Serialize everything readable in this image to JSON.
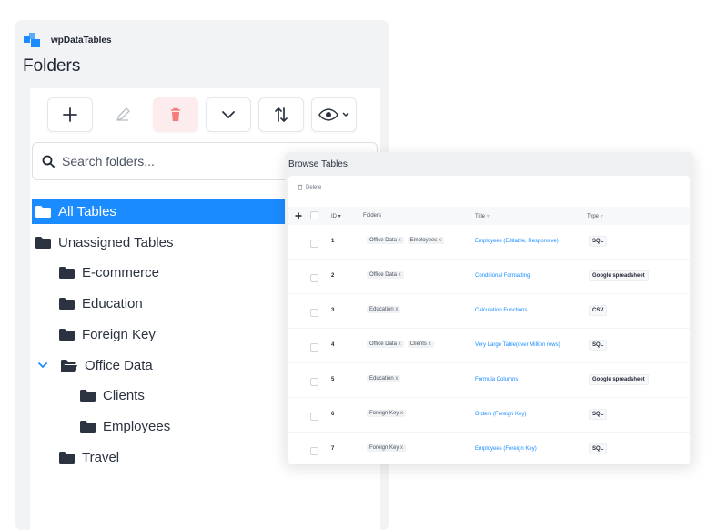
{
  "brand": {
    "name": "wpDataTables"
  },
  "folders_title": "Folders",
  "search": {
    "placeholder": "Search folders..."
  },
  "tree": {
    "all_tables": "All Tables",
    "unassigned": "Unassigned Tables",
    "ecommerce": "E-commerce",
    "education": "Education",
    "foreign_key": "Foreign Key",
    "office_data": "Office Data",
    "clients": "Clients",
    "employees": "Employees",
    "travel": "Travel"
  },
  "browse": {
    "title": "Browse Tables",
    "delete_label": "Delete",
    "headers": {
      "id": "ID",
      "folders": "Folders",
      "title": "Title",
      "type": "Type"
    },
    "rows": [
      {
        "id": "1",
        "folders": [
          "Office Data",
          "Employees"
        ],
        "title": "Employees (Editable, Responsive)",
        "type": "SQL"
      },
      {
        "id": "2",
        "folders": [
          "Office Data"
        ],
        "title": "Conditional Formatting",
        "type": "Google spreadsheet"
      },
      {
        "id": "3",
        "folders": [
          "Education"
        ],
        "title": "Calculation Functions",
        "type": "CSV"
      },
      {
        "id": "4",
        "folders": [
          "Office Data",
          "Clients"
        ],
        "title": "Very Large Table(over Million rows)",
        "type": "SQL"
      },
      {
        "id": "5",
        "folders": [
          "Education"
        ],
        "title": "Formula Columns",
        "type": "Google spreadsheet"
      },
      {
        "id": "6",
        "folders": [
          "Foreign Key"
        ],
        "title": "Orders (Foreign Key)",
        "type": "SQL"
      },
      {
        "id": "7",
        "folders": [
          "Foreign Key"
        ],
        "title": "Employees (Foreign Key)",
        "type": "SQL"
      }
    ]
  },
  "colors": {
    "accent": "#1a8cff",
    "danger": "#f47c7c",
    "panel": "#f2f3f5"
  }
}
